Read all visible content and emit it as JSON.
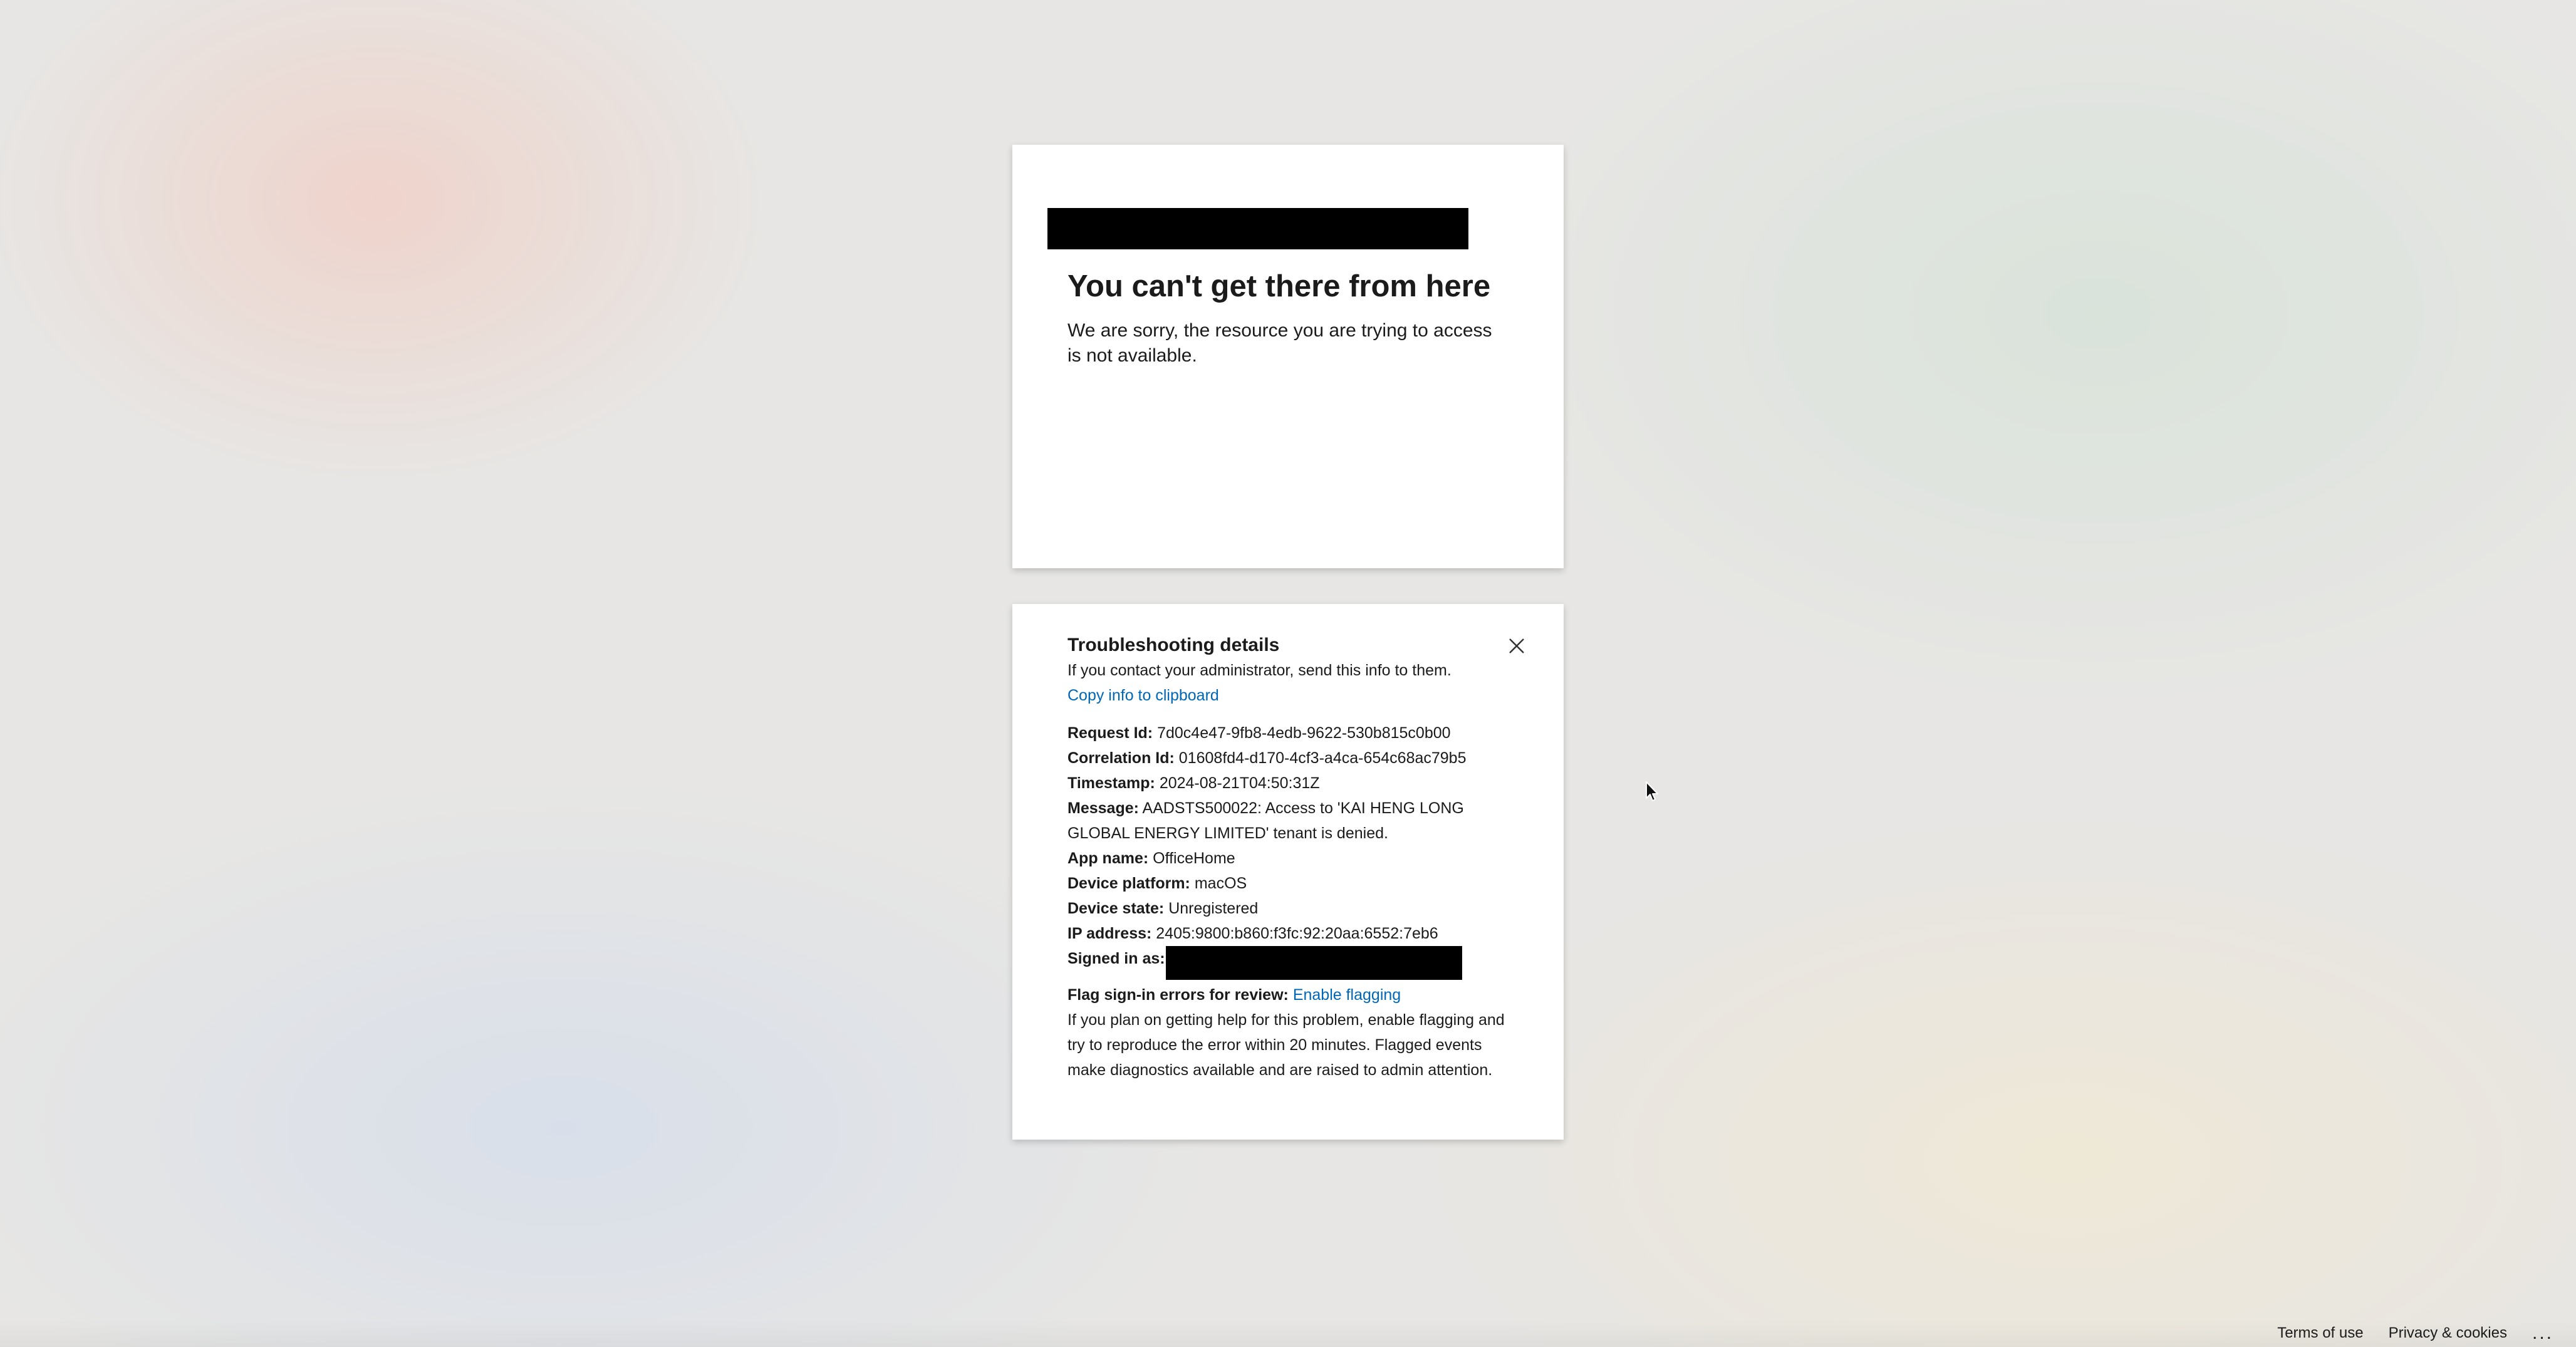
{
  "main": {
    "headline": "You can't get there from here",
    "description": "We are sorry, the resource you are trying to access is not available."
  },
  "details": {
    "title": "Troubleshooting details",
    "intro": "If you contact your administrator, send this info to them.",
    "copy_link": "Copy info to clipboard",
    "fields": {
      "request_id_label": "Request Id:",
      "request_id": "7d0c4e47-9fb8-4edb-9622-530b815c0b00",
      "correlation_id_label": "Correlation Id:",
      "correlation_id": "01608fd4-d170-4cf3-a4ca-654c68ac79b5",
      "timestamp_label": "Timestamp:",
      "timestamp": "2024-08-21T04:50:31Z",
      "message_label": "Message:",
      "message": "AADSTS500022: Access to 'KAI HENG LONG GLOBAL ENERGY LIMITED' tenant is denied.",
      "app_name_label": "App name:",
      "app_name": "OfficeHome",
      "device_platform_label": "Device platform:",
      "device_platform": "macOS",
      "device_state_label": "Device state:",
      "device_state": "Unregistered",
      "ip_address_label": "IP address:",
      "ip_address": "2405:9800:b860:f3fc:92:20aa:6552:7eb6",
      "signed_in_label": "Signed in as:"
    },
    "flag_label": "Flag sign-in errors for review:",
    "flag_link": "Enable flagging",
    "flag_text": "If you plan on getting help for this problem, enable flagging and try to reproduce the error within 20 minutes. Flagged events make diagnostics available and are raised to admin attention.",
    "close_icon": "close-icon"
  },
  "footer": {
    "terms": "Terms of use",
    "privacy": "Privacy & cookies",
    "more": "..."
  }
}
